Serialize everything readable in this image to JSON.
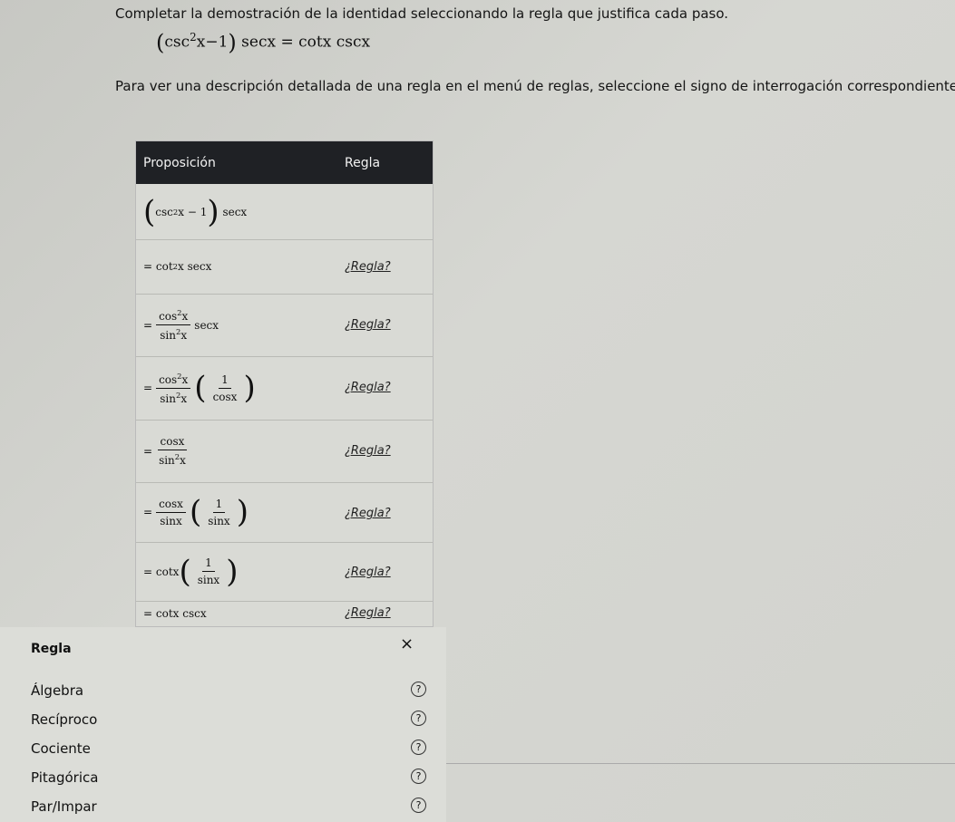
{
  "instructions": {
    "line1": "Completar la demostración de la identidad seleccionando la regla que justifica cada paso.",
    "line2": "Para ver una descripción detallada de una regla en el menú de reglas, seleccione el signo de interrogación correspondiente."
  },
  "identity": {
    "lhs_open": "(",
    "lhs_csc": "csc",
    "lhs_exp": "2",
    "lhs_x_minus_1": "x−1",
    "lhs_close": ")",
    "lhs_sec": "secx",
    "eq": "=",
    "rhs": "cotx cscx"
  },
  "table": {
    "header_prop": "Proposición",
    "header_rule": "Regla",
    "rule_link": "¿Regla?",
    "eq": "=",
    "one": "1",
    "cos": "cos",
    "sin": "sin",
    "cot": "cot",
    "sec": "secx",
    "x": "x",
    "two": "2",
    "cosx": "cosx",
    "sinx": "sinx",
    "cotx": "cotx",
    "csc": "csc",
    "minus1": "− 1",
    "lp": "(",
    "rp": ")",
    "final": "cotx cscx"
  },
  "rule_panel": {
    "title": "Regla",
    "close": "×",
    "help": "?",
    "items": [
      "Álgebra",
      "Recíproco",
      "Cociente",
      "Pitagórica",
      "Par/Impar"
    ]
  }
}
